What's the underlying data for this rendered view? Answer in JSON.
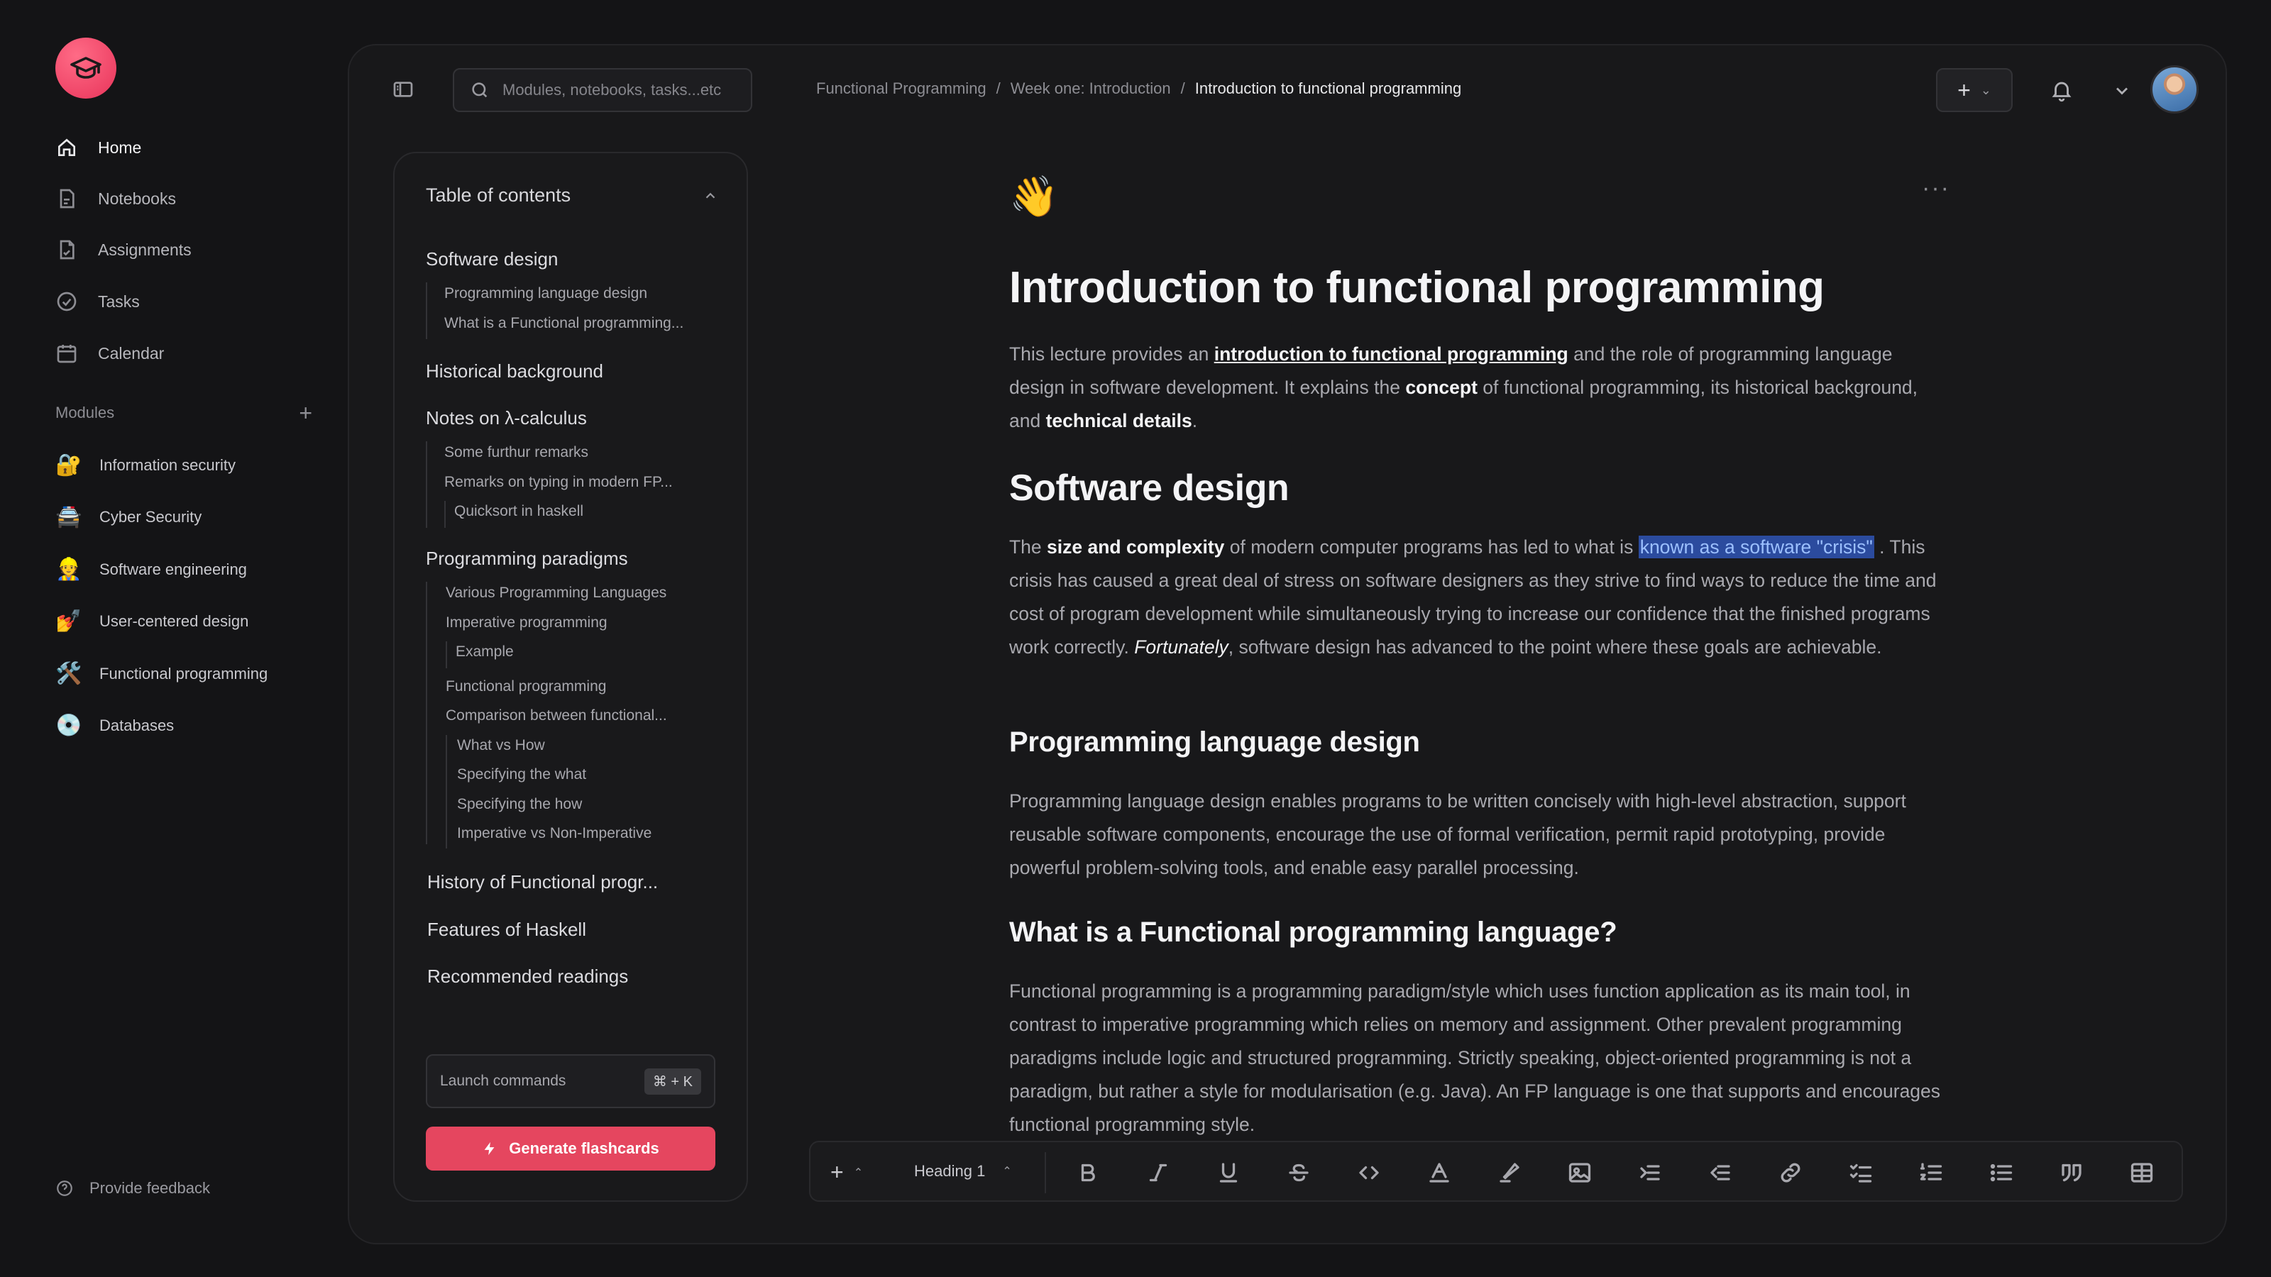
{
  "nav": {
    "items": [
      {
        "label": "Home",
        "icon": "home-icon"
      },
      {
        "label": "Notebooks",
        "icon": "notebook-icon"
      },
      {
        "label": "Assignments",
        "icon": "assignment-icon"
      },
      {
        "label": "Tasks",
        "icon": "check-circle-icon"
      },
      {
        "label": "Calendar",
        "icon": "calendar-icon"
      }
    ]
  },
  "modules": {
    "heading": "Modules",
    "items": [
      {
        "label": "Information security",
        "emoji": "🔐"
      },
      {
        "label": "Cyber Security",
        "emoji": "🚔"
      },
      {
        "label": "Software engineering",
        "emoji": "👷"
      },
      {
        "label": "User-centered design",
        "emoji": "💅"
      },
      {
        "label": "Functional programming",
        "emoji": "🛠️"
      },
      {
        "label": "Databases",
        "emoji": "💿"
      }
    ]
  },
  "feedback": {
    "label": "Provide feedback"
  },
  "search": {
    "placeholder": "Modules, notebooks, tasks...etc"
  },
  "breadcrumb": {
    "items": [
      "Functional Programming",
      "Week one: Introduction",
      "Introduction to functional programming"
    ],
    "separator": "/"
  },
  "toc": {
    "title": "Table of contents",
    "sections": [
      {
        "label": "Software design",
        "children": [
          "Programming language design",
          "What is a Functional programming..."
        ]
      },
      {
        "label": "Historical background",
        "children": []
      },
      {
        "label": "Notes on λ-calculus",
        "children": [
          "Some furthur remarks",
          "Remarks on typing in modern FP...",
          "Quicksort in haskell"
        ]
      },
      {
        "label": "Programming paradigms",
        "children": [
          "Various Programming Languages",
          "Imperative programming",
          "Example",
          "Functional programming",
          "Comparison between functional...",
          "What vs How",
          "Specifying the what",
          "Specifying the how",
          "Imperative vs Non-Imperative"
        ]
      },
      {
        "label": "History of Functional progr...",
        "children": []
      },
      {
        "label": "Features of Haskell",
        "children": []
      },
      {
        "label": "Recommended readings",
        "children": []
      }
    ],
    "launch_label": "Launch commands",
    "launch_shortcut": "⌘ + K",
    "generate_label": "Generate flashcards"
  },
  "doc": {
    "emoji": "👋",
    "title": "Introduction to functional programming",
    "intro": {
      "t1": "This lecture provides an ",
      "link": "introduction to functional programming",
      "t2": " and the role of programming language design in software development. It explains the ",
      "b1": "concept",
      "t3": " of functional programming, its historical background, and ",
      "b2": "technical details",
      "t4": "."
    },
    "h_software_design": "Software design",
    "sd": {
      "t1": "The ",
      "b1": "size and complexity",
      "t2": " of modern computer programs has led to what is ",
      "highlight": "known as a software \"crisis\"",
      "t3": " . This crisis has caused a great deal of stress on software designers as they strive to find ways to reduce the time and cost of program development while simultaneously trying to increase our confidence that the finished programs work correctly. ",
      "i1": "Fortunately",
      "t4": ", software design has advanced to the point where these goals are achievable."
    },
    "h_pld": "Programming language design",
    "pld": "Programming language design enables programs to be written concisely with high-level abstraction, support reusable software components, encourage the use of formal verification, permit rapid prototyping, provide powerful problem-solving tools, and enable easy parallel processing.",
    "h_fpl": "What is a Functional programming language?",
    "fpl": "Functional programming is a programming paradigm/style which uses function application as its main tool, in contrast to imperative programming which relies on memory and assignment. Other prevalent programming paradigms include logic and structured programming. Strictly speaking, object-oriented programming is not a paradigm, but rather a style for modularisation (e.g. Java). An FP language is one that supports and encourages functional programming style."
  },
  "toolbar": {
    "heading_select": "Heading 1"
  },
  "colors": {
    "accent": "#e5465f",
    "highlight_bg": "#2b4b9e",
    "background": "#141416"
  }
}
